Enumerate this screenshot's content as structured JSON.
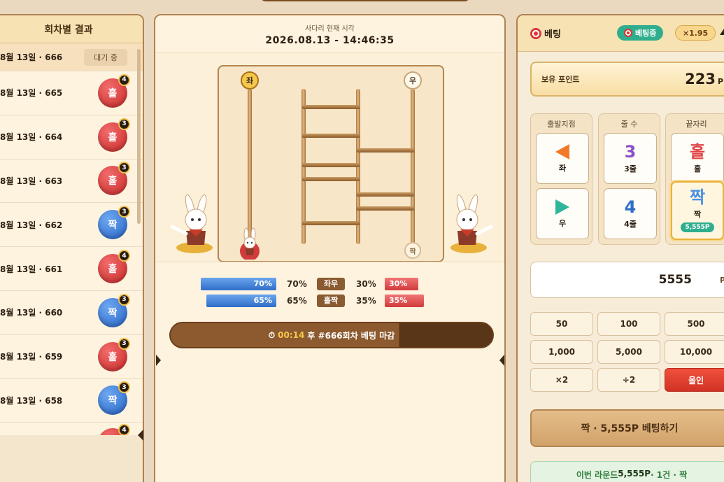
{
  "results_panel": {
    "title": "회차별 결과",
    "rows": [
      {
        "label": "8월 13일 · 666",
        "status": "대기 중"
      },
      {
        "label": "8월 13일 · 665",
        "result": "홀",
        "count": "4",
        "color": "red"
      },
      {
        "label": "8월 13일 · 664",
        "result": "홀",
        "count": "3",
        "color": "red"
      },
      {
        "label": "8월 13일 · 663",
        "result": "홀",
        "count": "3",
        "color": "red"
      },
      {
        "label": "8월 13일 · 662",
        "result": "짝",
        "count": "3",
        "color": "blue"
      },
      {
        "label": "8월 13일 · 661",
        "result": "홀",
        "count": "4",
        "color": "red"
      },
      {
        "label": "8월 13일 · 660",
        "result": "짝",
        "count": "3",
        "color": "blue"
      },
      {
        "label": "8월 13일 · 659",
        "result": "홀",
        "count": "3",
        "color": "red"
      },
      {
        "label": "8월 13일 · 658",
        "result": "짝",
        "count": "3",
        "color": "blue"
      },
      {
        "label": "",
        "result": "",
        "count": "4",
        "color": "red"
      }
    ]
  },
  "ladder": {
    "header_sub": "사다리 현재 시각",
    "header_time": "2026.08.13 - 14:46:35",
    "start_left": "좌",
    "start_right": "우",
    "end_right": "짝"
  },
  "stats": {
    "row1": {
      "left_bar": "70%",
      "left_pct": "70%",
      "tag": "좌우",
      "right_pct": "30%",
      "right_bar": "30%"
    },
    "row2": {
      "left_bar": "65%",
      "left_pct": "65%",
      "tag": "홀짝",
      "right_pct": "35%",
      "right_bar": "35%"
    }
  },
  "countdown": {
    "icon": "⏱",
    "time": "00:14",
    "text": "후 #666회차 베팅 마감"
  },
  "bet_panel": {
    "title": "베팅",
    "status_badge": "베팅중",
    "multiplier": "×1.95",
    "points_label": "보유 포인트",
    "points_value": "223",
    "points_unit": "P",
    "columns": {
      "start": {
        "title": "출발지점",
        "opt1_sub": "좌",
        "opt2_sub": "우"
      },
      "lines": {
        "title": "줄 수",
        "opt1_big": "3",
        "opt1_sub": "3줄",
        "opt2_big": "4",
        "opt2_sub": "4줄"
      },
      "end": {
        "title": "끝자리",
        "opt1_big": "홀",
        "opt1_sub": "홀",
        "opt2_big": "짝",
        "opt2_sub": "짝",
        "opt2_odds": "5,555P"
      }
    },
    "amount": "5555",
    "amount_unit": "P",
    "chips": [
      "50",
      "100",
      "500",
      "1,000",
      "5,000",
      "10,000",
      "×2",
      "÷2",
      "올인"
    ],
    "bet_button": "짝 · 5,555P 베팅하기",
    "summary_prefix": "이번 라운드 ",
    "summary_amount": "5,555P",
    "summary_suffix": " · 1건 · 짝"
  },
  "colors": {
    "accent_gold": "#f5c84b",
    "odd_red": "#d23b3b",
    "even_blue": "#2f6dca",
    "teal": "#2fae8e"
  }
}
